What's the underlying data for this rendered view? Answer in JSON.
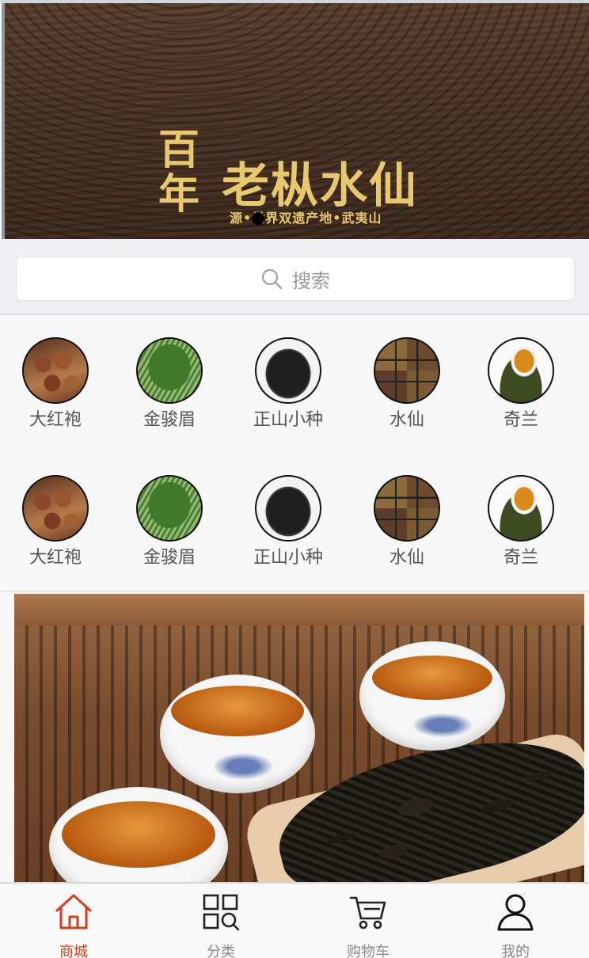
{
  "banner": {
    "title_small": "百年",
    "title": "老枞水仙",
    "subtitle": "源•世界双遗产地•武夷山",
    "active_slide": 1
  },
  "search": {
    "placeholder": "搜索",
    "icon": "search-icon"
  },
  "categories": {
    "rows": [
      [
        {
          "label": "大红袍",
          "icon": "dahongpao-image"
        },
        {
          "label": "金骏眉",
          "icon": "jinjunmei-image"
        },
        {
          "label": "正山小种",
          "icon": "zhengshan-xiaozhong-image"
        },
        {
          "label": "水仙",
          "icon": "shuixian-image"
        },
        {
          "label": "奇兰",
          "icon": "qilan-image"
        }
      ],
      [
        {
          "label": "大红袍",
          "icon": "dahongpao-image"
        },
        {
          "label": "金骏眉",
          "icon": "jinjunmei-image"
        },
        {
          "label": "正山小种",
          "icon": "zhengshan-xiaozhong-image"
        },
        {
          "label": "水仙",
          "icon": "shuixian-image"
        },
        {
          "label": "奇兰",
          "icon": "qilan-image"
        }
      ]
    ]
  },
  "tabbar": {
    "items": [
      {
        "label": "商城",
        "icon": "home-icon",
        "active": true
      },
      {
        "label": "分类",
        "icon": "category-grid-icon",
        "active": false
      },
      {
        "label": "购物车",
        "icon": "cart-icon",
        "active": false
      },
      {
        "label": "我的",
        "icon": "user-icon",
        "active": false
      }
    ],
    "active_color": "#d0401c",
    "inactive_color": "#8a8a8a"
  }
}
